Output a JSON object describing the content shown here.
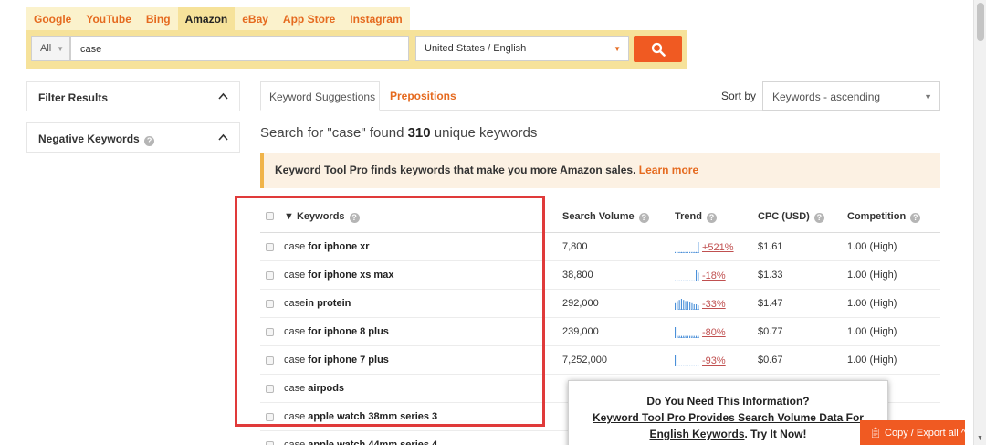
{
  "search": {
    "engines": [
      "Google",
      "YouTube",
      "Bing",
      "Amazon",
      "eBay",
      "App Store",
      "Instagram"
    ],
    "active_engine": "Amazon",
    "scope": "All",
    "query": "case",
    "locale": "United States / English",
    "search_icon": "magnifier-icon"
  },
  "sidebar": {
    "filter_label": "Filter Results",
    "negative_label": "Negative Keywords"
  },
  "results": {
    "tab_suggestions": "Keyword Suggestions",
    "tab_prepositions": "Prepositions",
    "sort_label": "Sort by",
    "sort_value": "Keywords - ascending",
    "found_prefix": "Search for \"case\" found",
    "found_count": "310",
    "found_suffix": "unique keywords",
    "promo_text": "Keyword Tool Pro finds keywords that make you more Amazon sales.",
    "promo_link": "Learn more"
  },
  "table": {
    "headers": {
      "keywords": "Keywords",
      "volume": "Search Volume",
      "trend": "Trend",
      "cpc": "CPC (USD)",
      "competition": "Competition"
    },
    "rows": [
      {
        "base": "case",
        "rest": " for iphone xr",
        "volume": "7,800",
        "trend": "+521%",
        "spark": [
          1,
          1,
          1,
          1,
          1,
          1,
          1,
          1,
          1,
          1,
          1,
          10
        ],
        "cpc": "$1.61",
        "competition": "1.00 (High)"
      },
      {
        "base": "case",
        "rest": " for iphone xs max",
        "volume": "38,800",
        "trend": "-18%",
        "spark": [
          1,
          1,
          1,
          1,
          1,
          1,
          1,
          1,
          1,
          1,
          10,
          8
        ],
        "cpc": "$1.33",
        "competition": "1.00 (High)"
      },
      {
        "base": "case",
        "rest": "in protein",
        "volume": "292,000",
        "trend": "-33%",
        "spark": [
          6,
          8,
          9,
          10,
          9,
          8,
          8,
          7,
          6,
          5,
          5,
          4
        ],
        "cpc": "$1.47",
        "competition": "1.00 (High)"
      },
      {
        "base": "case",
        "rest": " for iphone 8 plus",
        "volume": "239,000",
        "trend": "-80%",
        "spark": [
          10,
          2,
          2,
          2,
          2,
          2,
          2,
          2,
          2,
          2,
          2,
          2
        ],
        "cpc": "$0.77",
        "competition": "1.00 (High)"
      },
      {
        "base": "case",
        "rest": " for iphone 7 plus",
        "volume": "7,252,000",
        "trend": "-93%",
        "spark": [
          10,
          1,
          1,
          1,
          1,
          1,
          1,
          1,
          1,
          1,
          1,
          1
        ],
        "cpc": "$0.67",
        "competition": "1.00 (High)"
      },
      {
        "base": "case",
        "rest": " airpods",
        "volume": "",
        "trend": "",
        "spark": [],
        "cpc": "",
        "competition": ""
      },
      {
        "base": "case",
        "rest": " apple watch 38mm series 3",
        "volume": "",
        "trend": "",
        "spark": [],
        "cpc": "",
        "competition": ""
      },
      {
        "base": "case",
        "rest": " apple watch 44mm series 4",
        "volume": "",
        "trend": "",
        "spark": [],
        "cpc": "",
        "competition": ""
      }
    ]
  },
  "popup": {
    "line1": "Do You Need This Information?",
    "line2": "Keyword Tool Pro Provides Search Volume Data For",
    "line3_link": "English Keywords",
    "line3_rest": ". Try It Now!"
  },
  "export": {
    "label": "Copy / Export all"
  },
  "colors": {
    "accent": "#f05a22",
    "tab_bar": "#f6e29a",
    "highlight": "#e03a3a",
    "spark": "#4a90d9"
  }
}
